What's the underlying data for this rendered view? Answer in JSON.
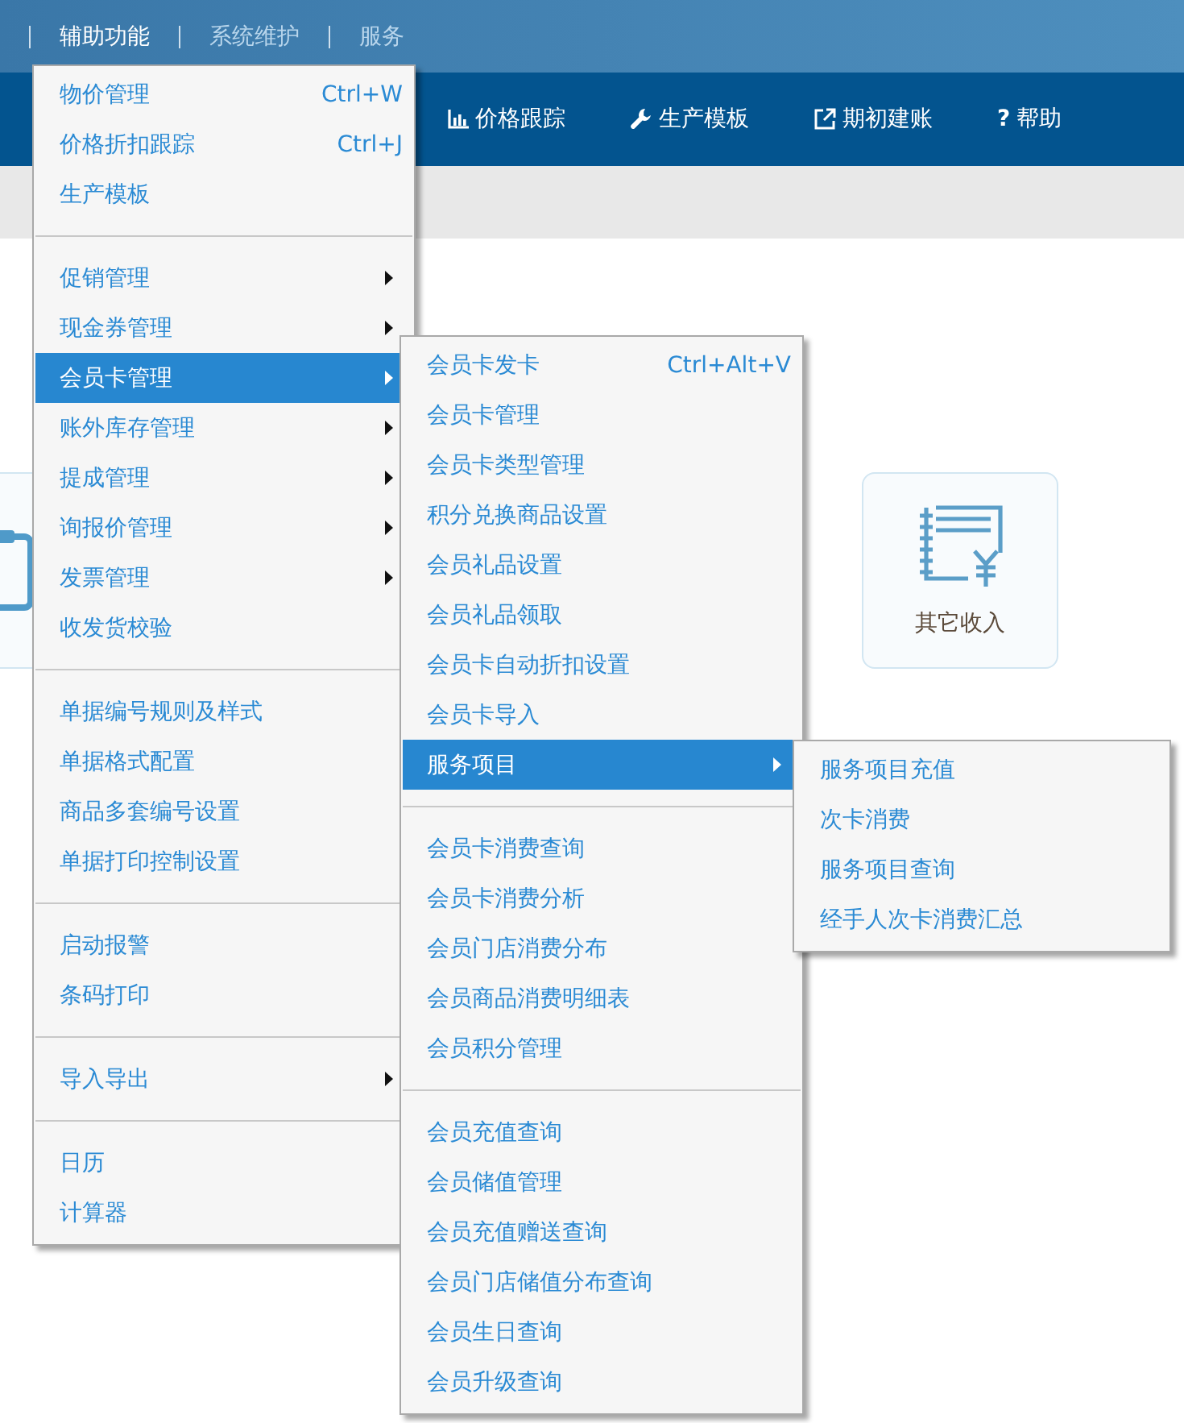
{
  "top_menu": [
    {
      "label": "辅助功能",
      "selected": true
    },
    {
      "label": "系统维护",
      "selected": false
    },
    {
      "label": "服务",
      "selected": false
    }
  ],
  "toolbar": [
    {
      "kind": "chart",
      "label": "价格跟踪"
    },
    {
      "kind": "wrench",
      "label": "生产模板"
    },
    {
      "kind": "link",
      "label": "期初建账"
    },
    {
      "kind": "help",
      "glyph": "?",
      "label": "帮助"
    }
  ],
  "cards": [
    {
      "kind": "clipboard"
    },
    {
      "kind": "ledger",
      "label": "其它收入"
    }
  ],
  "menu": [
    {
      "kind": "item",
      "label": "物价管理",
      "shortcut": "Ctrl+W",
      "submenu": false,
      "selected": false
    },
    {
      "kind": "item",
      "label": "价格折扣跟踪",
      "shortcut": "Ctrl+J",
      "submenu": false,
      "selected": false
    },
    {
      "kind": "item",
      "label": "生产模板",
      "submenu": false,
      "selected": false
    },
    {
      "kind": "separator"
    },
    {
      "kind": "item",
      "label": "促销管理",
      "submenu": true,
      "selected": false
    },
    {
      "kind": "item",
      "label": "现金券管理",
      "submenu": true,
      "selected": false
    },
    {
      "kind": "item",
      "label": "会员卡管理",
      "submenu": true,
      "selected": true
    },
    {
      "kind": "item",
      "label": "账外库存管理",
      "submenu": true,
      "selected": false
    },
    {
      "kind": "item",
      "label": "提成管理",
      "submenu": true,
      "selected": false
    },
    {
      "kind": "item",
      "label": "询报价管理",
      "submenu": true,
      "selected": false
    },
    {
      "kind": "item",
      "label": "发票管理",
      "submenu": true,
      "selected": false
    },
    {
      "kind": "item",
      "label": "收发货校验",
      "submenu": false,
      "selected": false
    },
    {
      "kind": "separator"
    },
    {
      "kind": "item",
      "label": "单据编号规则及样式",
      "submenu": false,
      "selected": false
    },
    {
      "kind": "item",
      "label": "单据格式配置",
      "submenu": false,
      "selected": false
    },
    {
      "kind": "item",
      "label": "商品多套编号设置",
      "submenu": false,
      "selected": false
    },
    {
      "kind": "item",
      "label": "单据打印控制设置",
      "submenu": false,
      "selected": false
    },
    {
      "kind": "separator"
    },
    {
      "kind": "item",
      "label": "启动报警",
      "submenu": false,
      "selected": false
    },
    {
      "kind": "item",
      "label": "条码打印",
      "submenu": false,
      "selected": false
    },
    {
      "kind": "separator"
    },
    {
      "kind": "item",
      "label": "导入导出",
      "submenu": true,
      "selected": false
    },
    {
      "kind": "separator"
    },
    {
      "kind": "item",
      "label": "日历",
      "submenu": false,
      "selected": false
    },
    {
      "kind": "item",
      "label": "计算器",
      "submenu": false,
      "selected": false
    }
  ],
  "submenu": [
    {
      "kind": "item",
      "label": "会员卡发卡",
      "shortcut": "Ctrl+Alt+V",
      "submenu": false,
      "selected": false
    },
    {
      "kind": "item",
      "label": "会员卡管理",
      "submenu": false,
      "selected": false
    },
    {
      "kind": "item",
      "label": "会员卡类型管理",
      "submenu": false,
      "selected": false
    },
    {
      "kind": "item",
      "label": "积分兑换商品设置",
      "submenu": false,
      "selected": false
    },
    {
      "kind": "item",
      "label": "会员礼品设置",
      "submenu": false,
      "selected": false
    },
    {
      "kind": "item",
      "label": "会员礼品领取",
      "submenu": false,
      "selected": false
    },
    {
      "kind": "item",
      "label": "会员卡自动折扣设置",
      "submenu": false,
      "selected": false
    },
    {
      "kind": "item",
      "label": "会员卡导入",
      "submenu": false,
      "selected": false
    },
    {
      "kind": "item",
      "label": "服务项目",
      "submenu": true,
      "selected": true
    },
    {
      "kind": "separator"
    },
    {
      "kind": "item",
      "label": "会员卡消费查询",
      "submenu": false,
      "selected": false
    },
    {
      "kind": "item",
      "label": "会员卡消费分析",
      "submenu": false,
      "selected": false
    },
    {
      "kind": "item",
      "label": "会员门店消费分布",
      "submenu": false,
      "selected": false
    },
    {
      "kind": "item",
      "label": "会员商品消费明细表",
      "submenu": false,
      "selected": false
    },
    {
      "kind": "item",
      "label": "会员积分管理",
      "submenu": false,
      "selected": false
    },
    {
      "kind": "separator"
    },
    {
      "kind": "item",
      "label": "会员充值查询",
      "submenu": false,
      "selected": false
    },
    {
      "kind": "item",
      "label": "会员储值管理",
      "submenu": false,
      "selected": false
    },
    {
      "kind": "item",
      "label": "会员充值赠送查询",
      "submenu": false,
      "selected": false
    },
    {
      "kind": "item",
      "label": "会员门店储值分布查询",
      "submenu": false,
      "selected": false
    },
    {
      "kind": "item",
      "label": "会员生日查询",
      "submenu": false,
      "selected": false
    },
    {
      "kind": "item",
      "label": "会员升级查询",
      "submenu": false,
      "selected": false
    }
  ],
  "submenu_2": [
    {
      "kind": "item",
      "label": "服务项目充值",
      "submenu": false,
      "selected": false
    },
    {
      "kind": "item",
      "label": "次卡消费",
      "submenu": false,
      "selected": false
    },
    {
      "kind": "item",
      "label": "服务项目查询",
      "submenu": false,
      "selected": false
    },
    {
      "kind": "item",
      "label": "经手人次卡消费汇总",
      "submenu": false,
      "selected": false
    }
  ]
}
